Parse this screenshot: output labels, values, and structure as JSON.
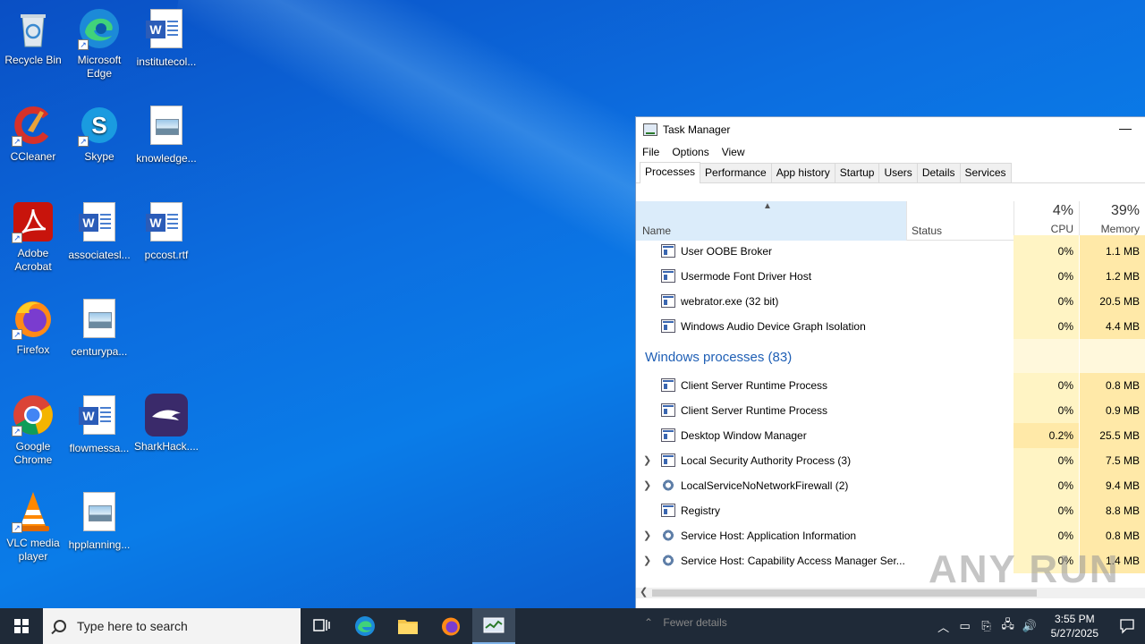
{
  "desktop": {
    "icons": [
      {
        "label": "Recycle Bin"
      },
      {
        "label": "Microsoft Edge"
      },
      {
        "label": "institutecol..."
      },
      {
        "label": "CCleaner"
      },
      {
        "label": "Skype"
      },
      {
        "label": "knowledge..."
      },
      {
        "label": "Adobe Acrobat"
      },
      {
        "label": "associatesl..."
      },
      {
        "label": "pccost.rtf"
      },
      {
        "label": "Firefox"
      },
      {
        "label": "centurypa..."
      },
      {
        "label": "Google Chrome"
      },
      {
        "label": "flowmessa..."
      },
      {
        "label": "SharkHack...."
      },
      {
        "label": "VLC media player"
      },
      {
        "label": "hpplanning..."
      }
    ]
  },
  "task_manager": {
    "title": "Task Manager",
    "menu": [
      "File",
      "Options",
      "View"
    ],
    "tabs": [
      "Processes",
      "Performance",
      "App history",
      "Startup",
      "Users",
      "Details",
      "Services"
    ],
    "columns": {
      "name": "Name",
      "status": "Status",
      "cpu_pct": "4%",
      "cpu": "CPU",
      "mem_pct": "39%",
      "mem": "Memory"
    },
    "rows_top": [
      {
        "name": "User OOBE Broker",
        "cpu": "0%",
        "mem": "1.1 MB"
      },
      {
        "name": "Usermode Font Driver Host",
        "cpu": "0%",
        "mem": "1.2 MB"
      },
      {
        "name": "webrator.exe (32 bit)",
        "cpu": "0%",
        "mem": "20.5 MB"
      },
      {
        "name": "Windows Audio Device Graph Isolation",
        "cpu": "0%",
        "mem": "4.4 MB"
      }
    ],
    "group_label": "Windows processes (83)",
    "rows_windows": [
      {
        "name": "Client Server Runtime Process",
        "cpu": "0%",
        "mem": "0.8 MB"
      },
      {
        "name": "Client Server Runtime Process",
        "cpu": "0%",
        "mem": "0.9 MB"
      },
      {
        "name": "Desktop Window Manager",
        "cpu": "0.2%",
        "mem": "25.5 MB"
      },
      {
        "name": "Local Security Authority Process (3)",
        "cpu": "0%",
        "mem": "7.5 MB"
      },
      {
        "name": "LocalServiceNoNetworkFirewall (2)",
        "cpu": "0%",
        "mem": "9.4 MB"
      },
      {
        "name": "Registry",
        "cpu": "0%",
        "mem": "8.8 MB"
      },
      {
        "name": "Service Host: Application Information",
        "cpu": "0%",
        "mem": "0.8 MB"
      },
      {
        "name": "Service Host: Capability Access Manager Ser...",
        "cpu": "0%",
        "mem": "1.4 MB"
      }
    ],
    "fewer_details": "Fewer details"
  },
  "watermark": "ANY RUN",
  "taskbar": {
    "search_placeholder": "Type here to search",
    "time": "3:55 PM",
    "date": "5/27/2025"
  }
}
